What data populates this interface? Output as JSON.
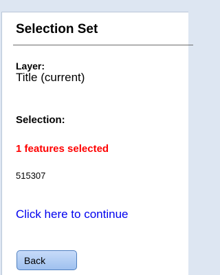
{
  "panel": {
    "title": "Selection Set"
  },
  "layer": {
    "label": "Layer:",
    "value": "Title (current)"
  },
  "selection": {
    "label": "Selection:",
    "count_text": "1 features selected",
    "feature_id": "515307"
  },
  "actions": {
    "continue_link": "Click here to continue",
    "back_button": "Back"
  },
  "colors": {
    "page_background": "#dde6f2",
    "count_text": "#ff0000",
    "link": "#0000ee",
    "button_fill": "#b3cff4",
    "button_border": "#4f7fbf"
  }
}
